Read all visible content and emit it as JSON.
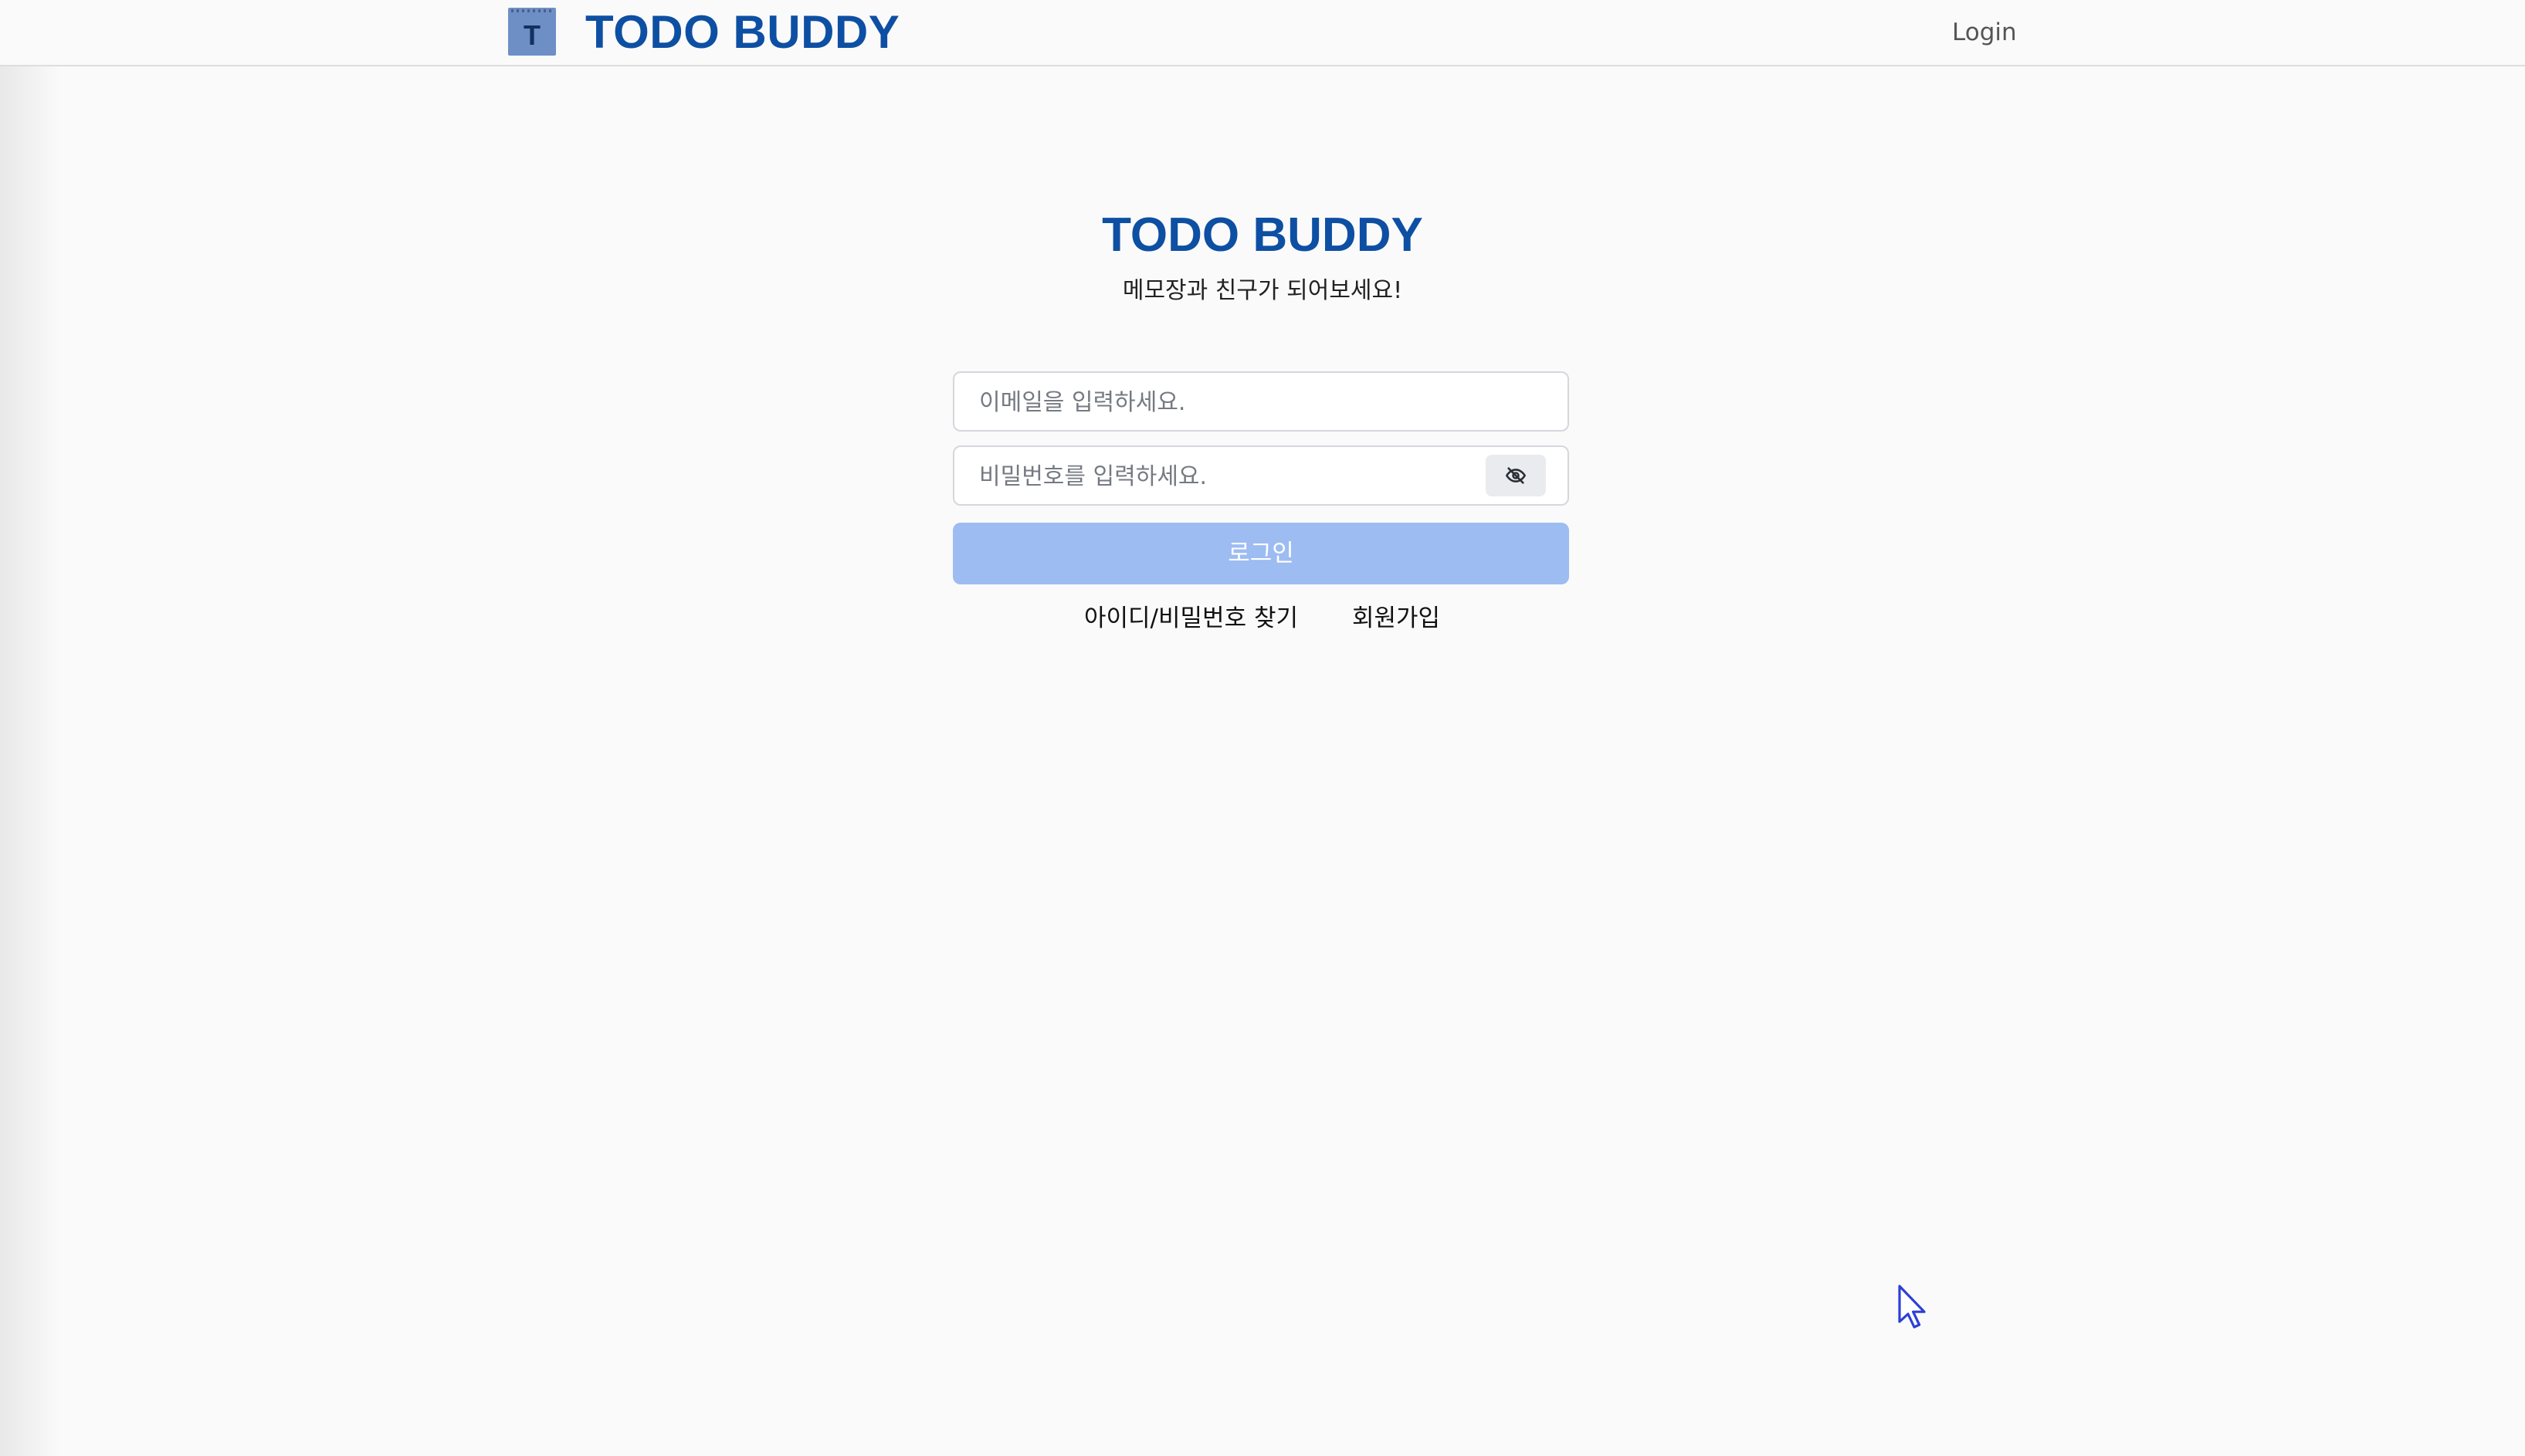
{
  "header": {
    "logo_letter": "T",
    "brand": "TODO BUDDY",
    "login_link": "Login"
  },
  "main": {
    "title": "TODO BUDDY",
    "subtitle": "메모장과 친구가 되어보세요!",
    "email_placeholder": "이메일을 입력하세요.",
    "password_placeholder": "비밀번호를 입력하세요.",
    "login_button": "로그인",
    "find_account_link": "아이디/비밀번호 찾기",
    "signup_link": "회원가입"
  },
  "icons": {
    "logo": "notepad-icon",
    "password_toggle": "eye-off-icon",
    "cursor": "mouse-pointer-icon"
  },
  "colors": {
    "brand": "#0d4fa3",
    "logo_bg": "#6d8fc6",
    "login_button_bg": "#9dbcf1",
    "page_bg": "#fafafa"
  }
}
